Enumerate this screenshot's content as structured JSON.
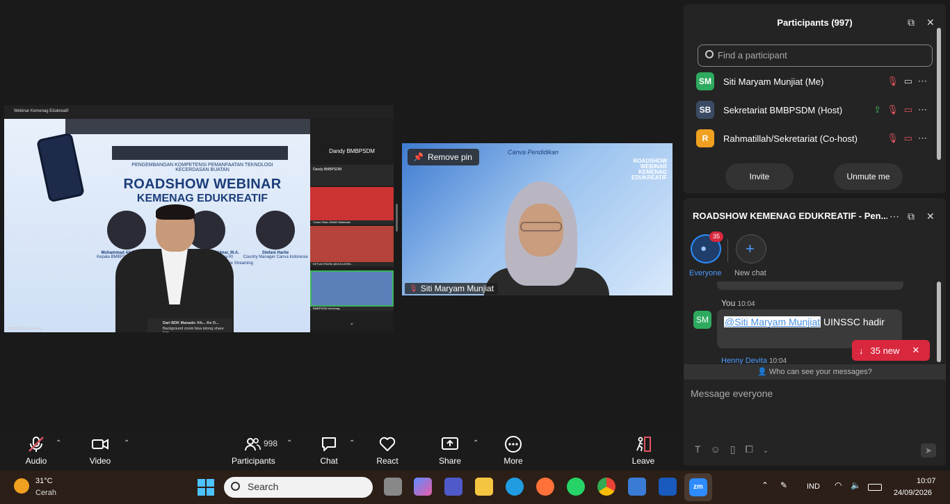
{
  "share": {
    "window_title": "Webinar Kemenag Edukreatif",
    "subtitle": "PENGEMBANGAN KOMPETENSI PEMANFAATAN TEKNOLOGI KECERDASAN BUATAN",
    "title_line1": "ROADSHOW WEBINAR",
    "title_line2": "KEMENAG EDUKREATIF",
    "speakers": [
      {
        "name": "Muhammad Ali Ramdhani",
        "role": "Kepala BMBPSDM Kemenag RI"
      },
      {
        "name": "Nasaruddin Umar, M.A.",
        "role": "Menteri Agama RI"
      },
      {
        "name": "Stefani Harlie",
        "role": "Country Manager Canva Indonesia"
      }
    ],
    "livestream": "Live Streaming",
    "toast_name": "Dari BDK Manado: Kh... Ke O...",
    "toast_text": "Background zoom bisa tolong share lagi",
    "side_name": "Dandy BMBPSDM",
    "side_label1": "Dandy BMBPSDM",
    "side_label2": "Yunus Sinbu SMAN Wakimala",
    "side_label3": "KETUA STAHN JAYA KLATEN...",
    "side_label4": "BMBPSDM Kemenag",
    "bottom_label": "BMBPSDM Kemenag"
  },
  "camera": {
    "remove_pin": "Remove pin",
    "name": "Siti Maryam Munjiat",
    "brand": "Canva Pendidikan",
    "slide_text": "ROADSHOW WEBINAR KEMENAG EDUKREATIF"
  },
  "toolbar": {
    "audio": "Audio",
    "video": "Video",
    "participants": "Participants",
    "participant_count": "998",
    "chat": "Chat",
    "react": "React",
    "share": "Share",
    "more": "More",
    "leave": "Leave"
  },
  "participants_panel": {
    "title": "Participants (997)",
    "search_placeholder": "Find a participant",
    "rows": [
      {
        "initials": "SM",
        "name": "Siti Maryam Munjiat (Me)",
        "color": "#2eaa5f"
      },
      {
        "initials": "SB",
        "name": "Sekretariat BMBPSDM (Host)",
        "color": "#3b4b63"
      },
      {
        "initials": "R",
        "name": "Rahmatillah/Sekretariat (Co-host)",
        "color": "#f0a020"
      }
    ],
    "invite": "Invite",
    "unmute": "Unmute me"
  },
  "chat_panel": {
    "title": "ROADSHOW KEMENAG EDUKREATIF - Pen...",
    "everyone_label": "Everyone",
    "everyone_badge": "35",
    "new_chat_label": "New chat",
    "msg_sender": "You",
    "msg_time": "10:04",
    "msg_avatar": "SM",
    "msg_mention": "@Siti Maryam Munjiat",
    "msg_text": " UINSSC hadir",
    "next_sender": "Henny Devita",
    "next_time": "10:04",
    "new_badge": "35 new",
    "who_can_see": "Who can see your messages?",
    "input_placeholder": "Message everyone"
  },
  "taskbar": {
    "weather_temp": "31°C",
    "weather_desc": "Cerah",
    "search": "Search",
    "lang": "IND",
    "time": "10:07",
    "date": "24/09/2026"
  }
}
